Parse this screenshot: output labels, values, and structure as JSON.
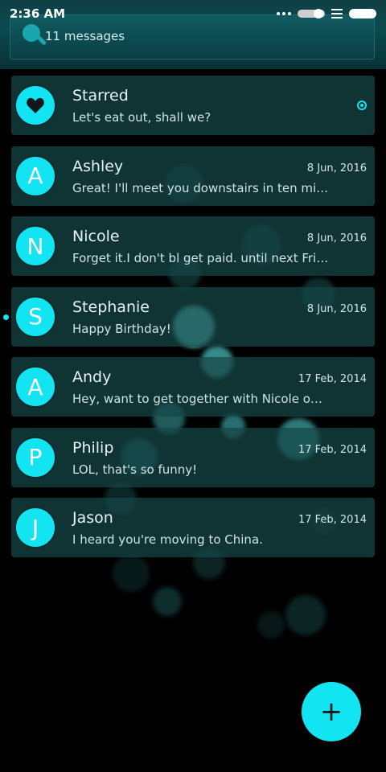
{
  "status_bar": {
    "time": "2:36 AM"
  },
  "header": {
    "message_count": "11 messages"
  },
  "conversations": [
    {
      "name": "Starred",
      "preview": "Let's eat out, shall we?",
      "date": "",
      "avatar": "heart"
    },
    {
      "name": "Ashley",
      "preview": "Great! I'll meet you downstairs in ten minut…",
      "date": "8 Jun, 2016",
      "avatar": "A"
    },
    {
      "name": "Nicole",
      "preview": "Forget it.I don't bl get paid. until next Friday.",
      "date": "8 Jun, 2016",
      "avatar": "N"
    },
    {
      "name": "Stephanie",
      "preview": "Happy Birthday!",
      "date": "8 Jun, 2016",
      "avatar": "S",
      "unread": true
    },
    {
      "name": "Andy",
      "preview": "Hey, want to get together with Nicole on Fr…",
      "date": "17 Feb, 2014",
      "avatar": "A"
    },
    {
      "name": "Philip",
      "preview": "LOL, that's so funny!",
      "date": "17 Feb, 2014",
      "avatar": "P"
    },
    {
      "name": "Jason",
      "preview": "I heard you're moving to China.",
      "date": "17 Feb, 2014",
      "avatar": "J"
    }
  ],
  "fab": {
    "label": "+"
  },
  "colors": {
    "accent": "#12e4f2",
    "card": "#164648",
    "background": "#000000"
  }
}
